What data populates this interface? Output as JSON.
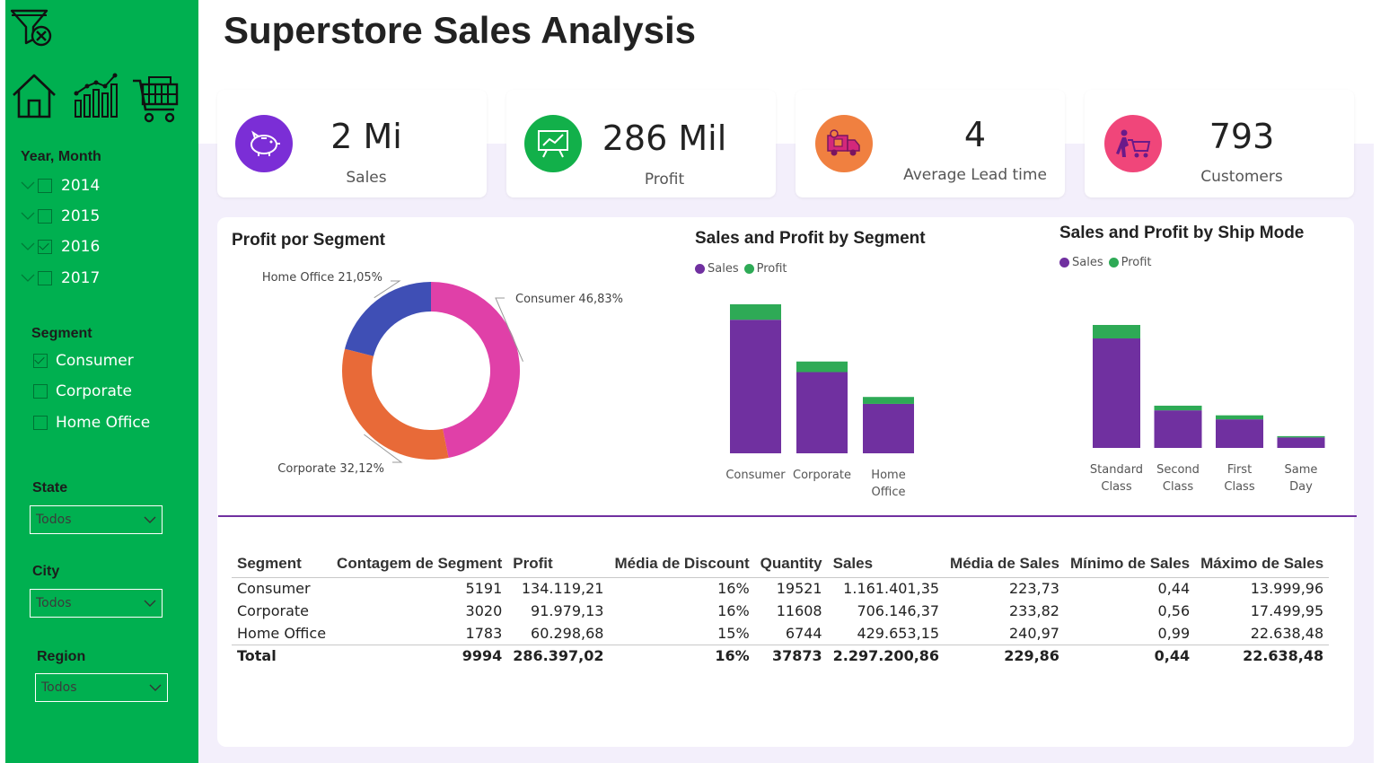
{
  "app": {
    "title": "Superstore Sales Analysis"
  },
  "nav": {
    "icons": [
      "filter-clear-icon",
      "home-icon",
      "chart-icon",
      "cart-icon"
    ]
  },
  "filters": {
    "year_month": {
      "title": "Year, Month",
      "years": [
        {
          "label": "2014",
          "checked": false
        },
        {
          "label": "2015",
          "checked": false
        },
        {
          "label": "2016",
          "checked": true
        },
        {
          "label": "2017",
          "checked": false
        }
      ]
    },
    "segment": {
      "title": "Segment",
      "options": [
        {
          "label": "Consumer",
          "checked": true
        },
        {
          "label": "Corporate",
          "checked": false
        },
        {
          "label": "Home Office",
          "checked": false
        }
      ]
    },
    "state": {
      "title": "State",
      "value": "Todos"
    },
    "city": {
      "title": "City",
      "value": "Todos"
    },
    "region": {
      "title": "Region",
      "value": "Todos"
    }
  },
  "kpis": [
    {
      "value": "2 Mi",
      "label": "Sales",
      "icon": "piggy-bank-icon",
      "color": "#7b2ed6"
    },
    {
      "value": "286 Mil",
      "label": "Profit",
      "icon": "presentation-chart-icon",
      "color": "#12b04a"
    },
    {
      "value": "4",
      "label": "Average Lead time",
      "icon": "delivery-truck-icon",
      "color": "#f08040"
    },
    {
      "value": "793",
      "label": "Customers",
      "icon": "shopping-customer-icon",
      "color": "#f0467a"
    }
  ],
  "colors": {
    "sales": "#7030a0",
    "profit": "#2eaa56",
    "consumer": "#e040a8",
    "corporate": "#e86a38",
    "home_office": "#3f4fb5",
    "accent_green": "#00b050"
  },
  "chart_data": [
    {
      "type": "pie",
      "title": "Profit por Segment",
      "categories": [
        "Consumer",
        "Corporate",
        "Home Office"
      ],
      "values": [
        46.83,
        32.12,
        21.05
      ],
      "labels": [
        "Consumer 46,83%",
        "Corporate 32,12%",
        "Home Office 21,05%"
      ],
      "donut": true
    },
    {
      "type": "bar",
      "stacked": true,
      "title": "Sales and Profit by Segment",
      "categories": [
        "Consumer",
        "Corporate",
        "Home Office"
      ],
      "category_lines": [
        [
          "Consumer"
        ],
        [
          "Corporate"
        ],
        [
          "Home",
          "Office"
        ]
      ],
      "series": [
        {
          "name": "Sales",
          "values": [
            1161401.35,
            706146.37,
            429653.15
          ]
        },
        {
          "name": "Profit",
          "values": [
            134119.21,
            91979.13,
            60298.68
          ]
        }
      ],
      "legend": "top-left",
      "ylim": [
        0,
        1295520.56
      ]
    },
    {
      "type": "bar",
      "stacked": true,
      "title": "Sales and Profit by Ship Mode",
      "categories": [
        "Standard Class",
        "Second Class",
        "First Class",
        "Same Day"
      ],
      "category_lines": [
        [
          "Standard",
          "Class"
        ],
        [
          "Second",
          "Class"
        ],
        [
          "First",
          "Class"
        ],
        [
          "Same",
          "Day"
        ]
      ],
      "series": [
        {
          "name": "Sales",
          "values": [
            1340000,
            460000,
            350000,
            128000
          ]
        },
        {
          "name": "Profit",
          "values": [
            165000,
            57000,
            49000,
            16000
          ]
        }
      ],
      "legend": "top-left",
      "ylim": [
        0,
        1505000
      ]
    }
  ],
  "table": {
    "columns": [
      "Segment",
      "Contagem de Segment",
      "Profit",
      "Média de Discount",
      "Quantity",
      "Sales",
      "Média de Sales",
      "Mínimo de Sales",
      "Máximo de Sales"
    ],
    "rows": [
      [
        "Consumer",
        "5191",
        "134.119,21",
        "16%",
        "19521",
        "1.161.401,35",
        "223,73",
        "0,44",
        "13.999,96"
      ],
      [
        "Corporate",
        "3020",
        "91.979,13",
        "16%",
        "11608",
        "706.146,37",
        "233,82",
        "0,56",
        "17.499,95"
      ],
      [
        "Home Office",
        "1783",
        "60.298,68",
        "15%",
        "6744",
        "429.653,15",
        "240,97",
        "0,99",
        "22.638,48"
      ]
    ],
    "total": [
      "Total",
      "9994",
      "286.397,02",
      "16%",
      "37873",
      "2.297.200,86",
      "229,86",
      "0,44",
      "22.638,48"
    ]
  }
}
